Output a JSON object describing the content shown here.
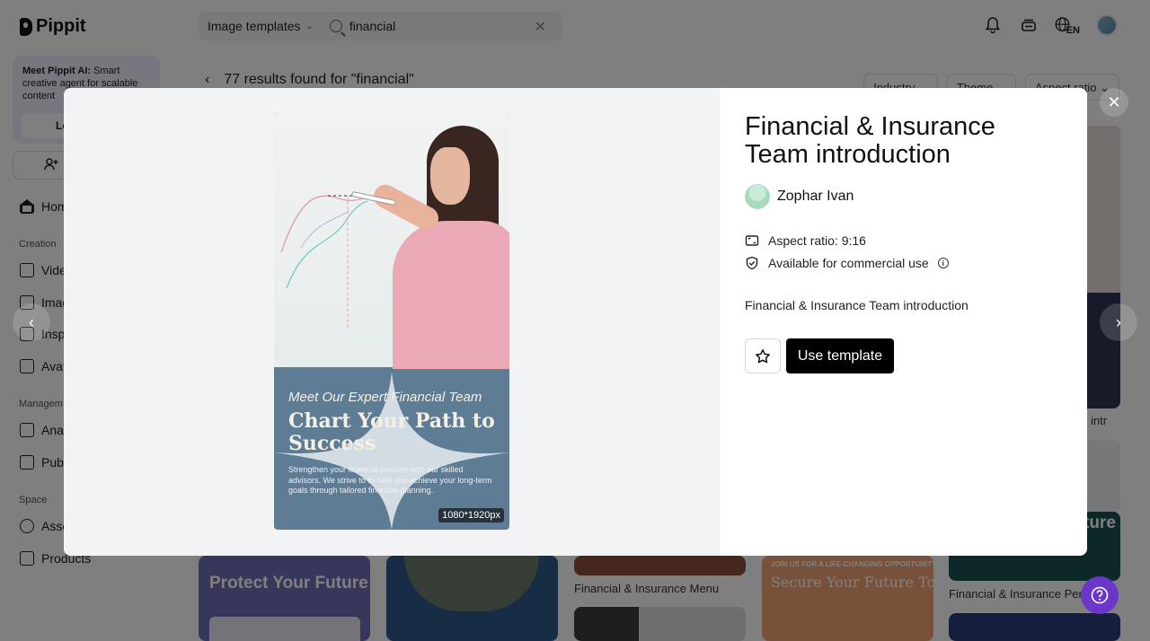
{
  "app": {
    "brand": "Pippit"
  },
  "search": {
    "type_label": "Image templates",
    "query": "financial",
    "clear_label": "✕"
  },
  "header_icons": [
    "bell-icon",
    "layers-icon",
    "language-icon",
    "avatar"
  ],
  "language": {
    "code": "EN"
  },
  "sidebar": {
    "promo_bold": "Meet Pippit AI:",
    "promo_text": " Smart creative agent for scalable content",
    "promo_button": "Le",
    "invite_label": "I",
    "sections": {
      "creation": "Creation",
      "management": "Managem",
      "space": "Space"
    },
    "items": [
      {
        "label": "Hom",
        "icon": "home-icon"
      },
      {
        "label": "Vide",
        "icon": "video-icon"
      },
      {
        "label": "Imag",
        "icon": "image-icon"
      },
      {
        "label": "Insp",
        "icon": "inspiration-icon"
      },
      {
        "label": "Avat",
        "icon": "avatar-icon"
      },
      {
        "label": "Anal",
        "icon": "analytics-icon"
      },
      {
        "label": "Publ",
        "icon": "publisher-icon"
      },
      {
        "label": "Asse",
        "icon": "assets-icon"
      },
      {
        "label": "Products",
        "icon": "products-icon"
      }
    ]
  },
  "results": {
    "back": "‹",
    "text": "77 results found for \"financial\""
  },
  "filters": [
    "Industry",
    "Theme",
    "Aspect ratio"
  ],
  "grid": {
    "captions": [
      "Financial & Insurance Menu",
      "Financial & Insurance Pers",
      "intr"
    ],
    "card_texts": [
      "Protect Your Future",
      "Secure Your Future Today",
      "JOIN US FOR A LIFE-CHANGING OPPORTUNITY",
      "ture"
    ]
  },
  "modal": {
    "title": "Financial & Insurance Team introduction",
    "author": "Zophar Ivan",
    "aspect_ratio": "Aspect ratio: 9:16",
    "commercial": "Available for commercial use",
    "description": "Financial & Insurance Team introduction",
    "use_button": "Use template",
    "close": "✕",
    "prev": "‹",
    "next": "›",
    "preview": {
      "subheading": "Meet Our Expert Financial Team",
      "heading": "Chart Your Path to Success",
      "body": "Strengthen your financial position with our skilled advisors. We strive to to help you achieve your long-term goals through tailored financial planning.",
      "dimensions": "1080*1920px"
    }
  },
  "colors": {
    "overlay": "#000000",
    "primary_button": "#000000",
    "help": "#6b37c9",
    "preview_bg": "#5f7c95"
  }
}
